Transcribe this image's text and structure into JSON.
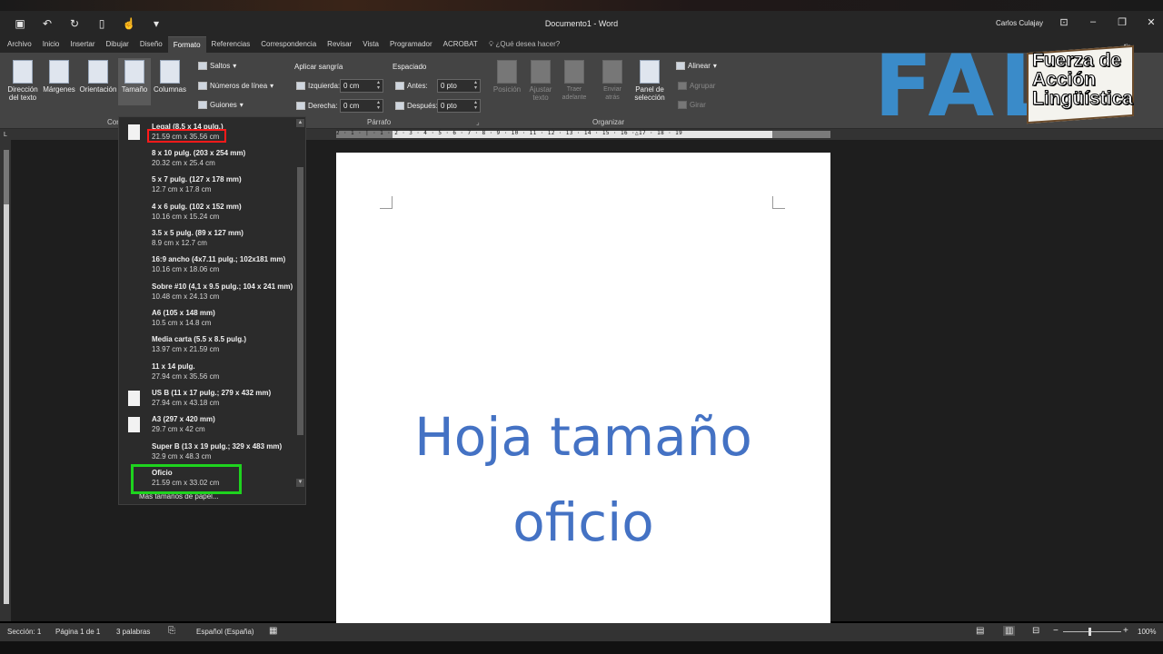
{
  "window": {
    "title": "Documento1 - Word",
    "user": "Carlos Culajay",
    "controls": [
      "minimize",
      "restore",
      "close"
    ]
  },
  "qat": {
    "icons": [
      "save-icon",
      "undo-icon",
      "redo-icon",
      "new-doc-icon",
      "touch-mode-icon",
      "customize-icon"
    ]
  },
  "tabs": [
    "Archivo",
    "Inicio",
    "Insertar",
    "Dibujar",
    "Diseño",
    "Formato",
    "Referencias",
    "Correspondencia",
    "Revisar",
    "Vista",
    "Programador",
    "ACROBAT",
    "¿Qué desea hacer?"
  ],
  "active_tab": "Formato",
  "ribbon": {
    "direccion": "Dirección del texto",
    "margenes": "Márgenes",
    "orientacion": "Orientación",
    "tamano": "Tamaño",
    "columnas": "Columnas",
    "saltos": "Saltos",
    "numeros_linea": "Números de línea",
    "guiones": "Guiones",
    "config_group_partial": "Cor",
    "sangria_title": "Aplicar sangría",
    "izquierda_label": "Izquierda:",
    "izquierda_value": "0 cm",
    "derecha_label": "Derecha:",
    "derecha_value": "0 cm",
    "espaciado_title": "Espaciado",
    "antes_label": "Antes:",
    "antes_value": "0 pto",
    "despues_label": "Después:",
    "despues_value": "0 pto",
    "parrafo_group": "Párrafo",
    "posicion": "Posición",
    "ajustar_texto": "Ajustar texto",
    "traer_adelante": "Traer adelante",
    "enviar_atras": "Enviar atrás",
    "panel_seleccion": "Panel de selección",
    "alinear": "Alinear",
    "agrupar": "Agrupar",
    "girar": "Girar",
    "organizar_group": "Organizar",
    "partial_right": "tir"
  },
  "logo": {
    "letters": "FAL",
    "line1": "Fuerza de",
    "line2": "Acción",
    "line3": "Lingüística"
  },
  "ruler": {
    "labels": "2 · 1 · | · 1 · 2 · 3 · 4 · 5 · 6 · 7 · 8 · 9 · 10 · 11 · 12 · 13 · 14 · 15 · 16 ·△17 · 18 · 19"
  },
  "paper_sizes": [
    {
      "name": "Legal (8.5 x 14 pulg.)",
      "dims": "21.59 cm x 35.56 cm",
      "icon": true
    },
    {
      "name": "8 x 10 pulg. (203 x 254 mm)",
      "dims": "20.32 cm x 25.4 cm",
      "icon": false
    },
    {
      "name": "5 x 7 pulg. (127 x 178 mm)",
      "dims": "12.7 cm x 17.8 cm",
      "icon": false
    },
    {
      "name": "4 x 6 pulg. (102 x 152 mm)",
      "dims": "10.16 cm x 15.24 cm",
      "icon": false
    },
    {
      "name": "3.5 x 5 pulg. (89 x 127 mm)",
      "dims": "8.9 cm x 12.7 cm",
      "icon": false
    },
    {
      "name": "16:9 ancho (4x7.11 pulg.; 102x181 mm)",
      "dims": "10.16 cm x 18.06 cm",
      "icon": false
    },
    {
      "name": "Sobre #10 (4,1 x 9.5 pulg.; 104 x 241 mm)",
      "dims": "10.48 cm x 24.13 cm",
      "icon": false
    },
    {
      "name": "A6 (105 x 148 mm)",
      "dims": "10.5 cm x 14.8 cm",
      "icon": false
    },
    {
      "name": "Media carta (5.5 x 8.5 pulg.)",
      "dims": "13.97 cm x 21.59 cm",
      "icon": false
    },
    {
      "name": "11 x 14 pulg.",
      "dims": "27.94 cm x 35.56 cm",
      "icon": false
    },
    {
      "name": "US B (11 x 17 pulg.; 279 x 432 mm)",
      "dims": "27.94 cm x 43.18 cm",
      "icon": true
    },
    {
      "name": "A3 (297 x 420 mm)",
      "dims": "29.7 cm x 42 cm",
      "icon": true
    },
    {
      "name": "Super B (13 x 19 pulg.; 329 x 483 mm)",
      "dims": "32.9 cm x 48.3 cm",
      "icon": false
    },
    {
      "name": "Oficio",
      "dims": "21.59 cm x 33.02 cm",
      "icon": false
    }
  ],
  "more_sizes": "Más tamaños de papel...",
  "document": {
    "line1": "Hoja tamaño",
    "line2": "oficio"
  },
  "status": {
    "seccion": "Sección: 1",
    "pagina": "Página 1 de 1",
    "palabras": "3 palabras",
    "idioma": "Español (España)",
    "zoom": "100%"
  }
}
